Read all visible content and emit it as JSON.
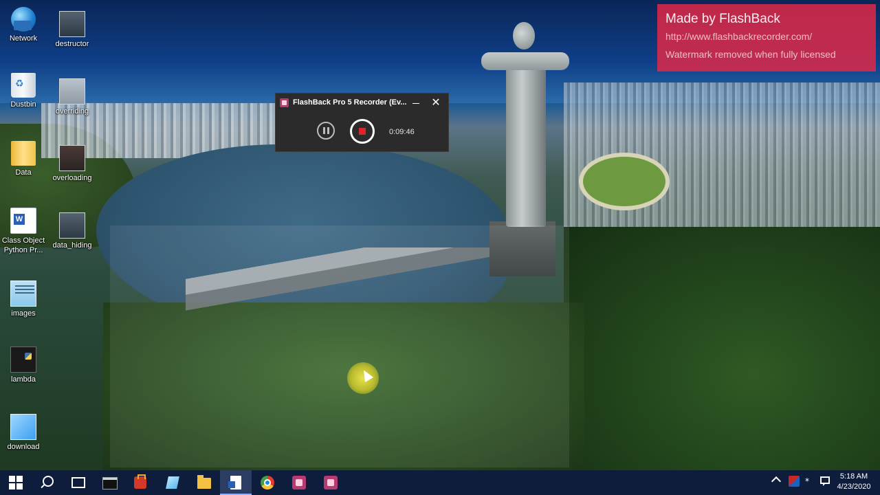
{
  "desktop": {
    "icons": [
      {
        "label": "Network",
        "icon": "network-icon"
      },
      {
        "label": "destructor",
        "icon": "image-thumbnail-icon"
      },
      {
        "label": "Dustbin",
        "icon": "recycle-bin-icon"
      },
      {
        "label": "overriding",
        "icon": "image-thumbnail-icon"
      },
      {
        "label": "Data",
        "icon": "folder-icon"
      },
      {
        "label": "overloading",
        "icon": "image-thumbnail-icon"
      },
      {
        "label": "Class Object Python Pr...",
        "icon": "word-document-icon"
      },
      {
        "label": "data_hiding",
        "icon": "image-thumbnail-icon"
      },
      {
        "label": "images",
        "icon": "image-file-icon"
      },
      {
        "label": "lambda",
        "icon": "image-thumbnail-icon"
      },
      {
        "label": "download",
        "icon": "image-file-icon"
      }
    ]
  },
  "watermark": {
    "title": "Made by FlashBack",
    "url": "http://www.flashbackrecorder.com/",
    "note": "Watermark removed when fully licensed",
    "color": "#e62846"
  },
  "recorder": {
    "title": "FlashBack Pro 5 Recorder (Ev...",
    "elapsed": "0:09:46",
    "stop_color": "#e0242c"
  },
  "taskbar": {
    "items": [
      {
        "name": "start-button",
        "icon": "windows-logo-icon",
        "active": false
      },
      {
        "name": "search-button",
        "icon": "search-icon",
        "active": false
      },
      {
        "name": "task-view-button",
        "icon": "task-view-icon",
        "active": false
      },
      {
        "name": "command-prompt-button",
        "icon": "terminal-icon",
        "active": false
      },
      {
        "name": "toolbox-app-button",
        "icon": "toolbox-icon",
        "active": false
      },
      {
        "name": "notes-app-button",
        "icon": "notes-icon",
        "active": false
      },
      {
        "name": "file-explorer-button",
        "icon": "folder-icon",
        "active": false
      },
      {
        "name": "python-document-button",
        "icon": "document-icon",
        "active": true
      },
      {
        "name": "chrome-button",
        "icon": "chrome-icon",
        "active": false
      },
      {
        "name": "flashback-player-button",
        "icon": "flashback-icon",
        "active": false
      },
      {
        "name": "flashback-recorder-button",
        "icon": "flashback-icon",
        "active": false
      }
    ],
    "clock": {
      "time": "5:18 AM",
      "date": "4/23/2020"
    }
  }
}
